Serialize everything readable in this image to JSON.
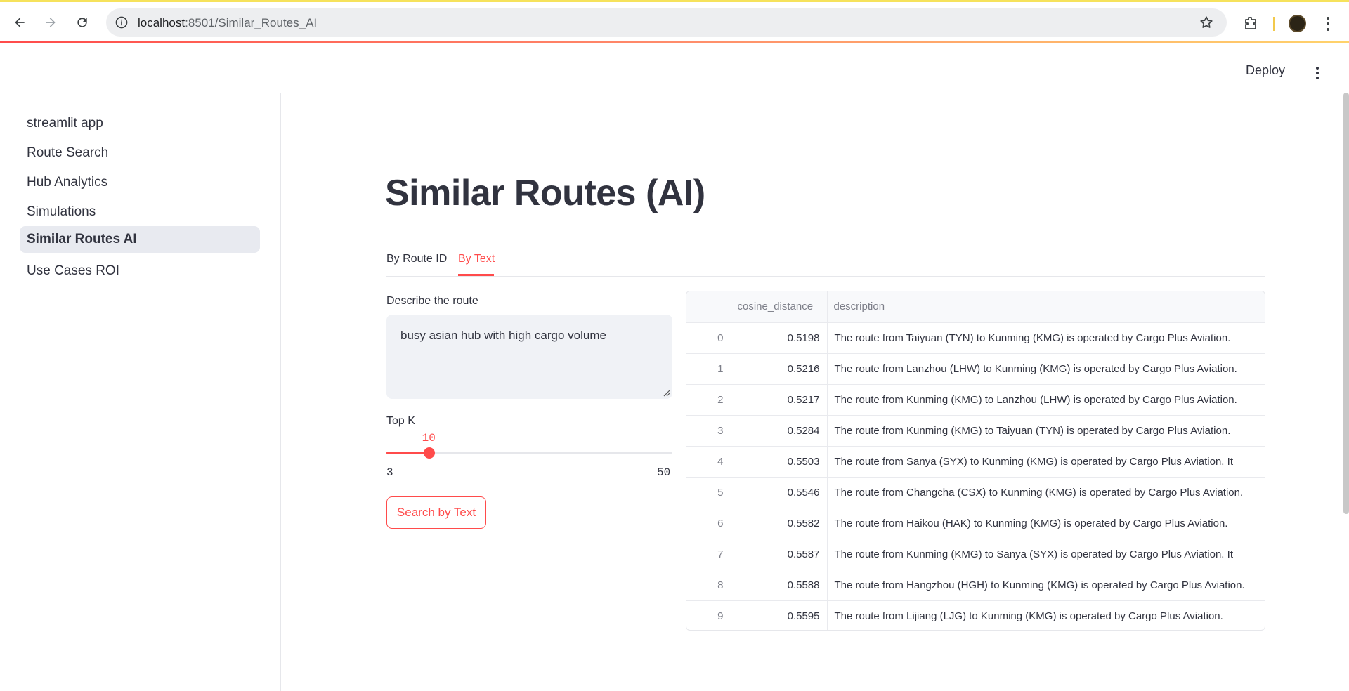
{
  "browser": {
    "url_host": "localhost",
    "url_path": ":8501/Similar_Routes_AI"
  },
  "header": {
    "deploy_label": "Deploy"
  },
  "sidebar": {
    "items": [
      {
        "label": "streamlit app"
      },
      {
        "label": "Route Search"
      },
      {
        "label": "Hub Analytics"
      },
      {
        "label": "Simulations"
      },
      {
        "label": "Similar Routes AI",
        "active": true
      },
      {
        "label": "Use Cases ROI"
      }
    ]
  },
  "main": {
    "title": "Similar Routes (AI)",
    "tabs": [
      {
        "label": "By Route ID"
      },
      {
        "label": "By Text",
        "active": true
      }
    ],
    "describe_label": "Describe the route",
    "describe_value": "busy asian hub with high cargo volume",
    "topk_label": "Top K",
    "topk_value": 10,
    "topk_value_text": "10",
    "topk_min": 3,
    "topk_min_text": "3",
    "topk_max": 50,
    "topk_max_text": "50",
    "search_button": "Search by Text"
  },
  "table": {
    "columns": [
      "",
      "cosine_distance",
      "description"
    ],
    "rows": [
      {
        "idx": "0",
        "dist": "0.5198",
        "desc": "The route from Taiyuan (TYN) to Kunming (KMG) is operated by Cargo Plus Aviation."
      },
      {
        "idx": "1",
        "dist": "0.5216",
        "desc": "The route from Lanzhou (LHW) to Kunming (KMG) is operated by Cargo Plus Aviation."
      },
      {
        "idx": "2",
        "dist": "0.5217",
        "desc": "The route from Kunming (KMG) to Lanzhou (LHW) is operated by Cargo Plus Aviation."
      },
      {
        "idx": "3",
        "dist": "0.5284",
        "desc": "The route from Kunming (KMG) to Taiyuan (TYN) is operated by Cargo Plus Aviation."
      },
      {
        "idx": "4",
        "dist": "0.5503",
        "desc": "The route from Sanya (SYX) to Kunming (KMG) is operated by Cargo Plus Aviation.     It"
      },
      {
        "idx": "5",
        "dist": "0.5546",
        "desc": "The route from Changcha (CSX) to Kunming (KMG) is operated by Cargo Plus Aviation."
      },
      {
        "idx": "6",
        "dist": "0.5582",
        "desc": "The route from Haikou (HAK) to Kunming (KMG) is operated by Cargo Plus Aviation."
      },
      {
        "idx": "7",
        "dist": "0.5587",
        "desc": "The route from Kunming (KMG) to Sanya (SYX) is operated by Cargo Plus Aviation.     It"
      },
      {
        "idx": "8",
        "dist": "0.5588",
        "desc": "The route from Hangzhou (HGH) to Kunming (KMG) is operated by Cargo Plus Aviation."
      },
      {
        "idx": "9",
        "dist": "0.5595",
        "desc": "The route from Lijiang (LJG) to Kunming (KMG) is operated by Cargo Plus Aviation."
      }
    ]
  },
  "colors": {
    "accent": "#ff4b4b",
    "text": "#31333f",
    "muted": "#7d7f89",
    "sidebar_active_bg": "#e8eaf0",
    "input_bg": "#f0f2f6"
  },
  "icons": [
    "back-arrow-icon",
    "forward-arrow-icon",
    "reload-icon",
    "site-info-icon",
    "bookmark-star-icon",
    "extensions-icon",
    "profile-avatar",
    "kebab-menu-icon"
  ]
}
